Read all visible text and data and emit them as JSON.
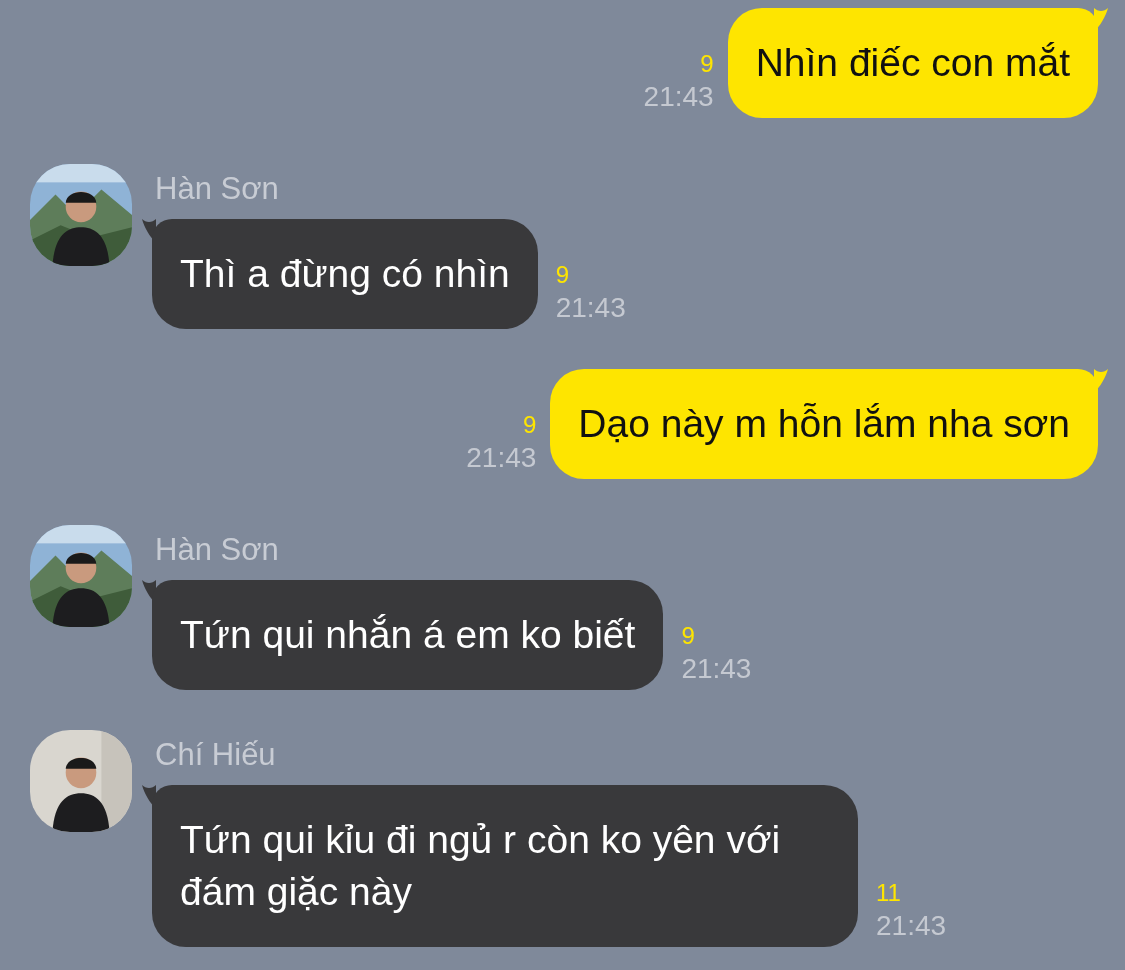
{
  "messages": [
    {
      "kind": "outgoing",
      "text": "Nhìn điếc con mắt",
      "unread": "9",
      "time": "21:43"
    },
    {
      "kind": "incoming",
      "sender": "Hàn Sơn",
      "text": "Thì a đừng có nhìn",
      "unread": "9",
      "time": "21:43"
    },
    {
      "kind": "outgoing",
      "text": "Dạo này m hỗn lắm nha sơn",
      "unread": "9",
      "time": "21:43"
    },
    {
      "kind": "incoming",
      "sender": "Hàn Sơn",
      "text": "Tứn qui nhắn á em ko biết",
      "unread": "9",
      "time": "21:43"
    },
    {
      "kind": "incoming",
      "sender": "Chí Hiếu",
      "text": "Tứn qui kỉu đi ngủ r còn ko yên với đám giặc này",
      "unread": "11",
      "time": "21:43"
    }
  ]
}
